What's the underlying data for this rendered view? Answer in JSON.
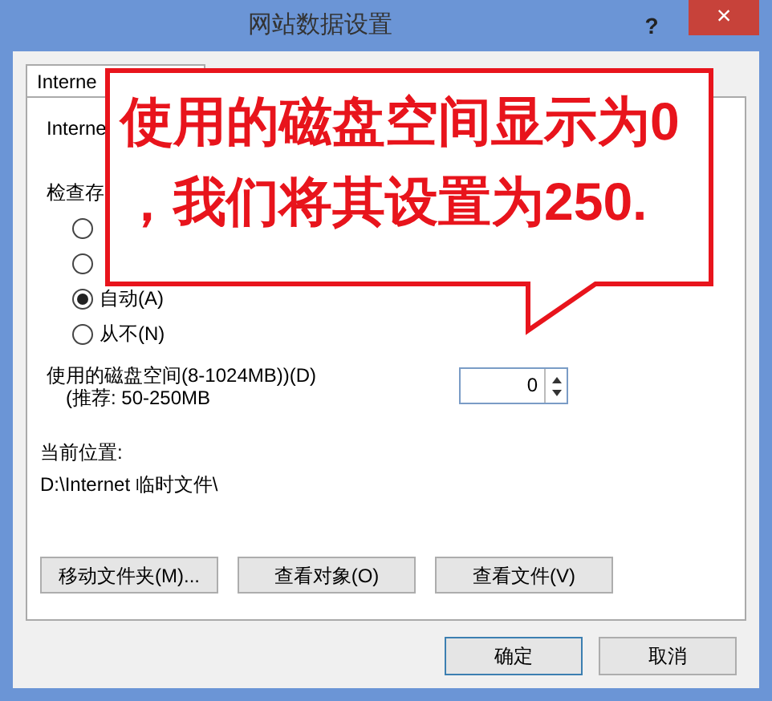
{
  "window": {
    "title": "网站数据设置",
    "help": "?",
    "close": "×"
  },
  "tabs": [
    {
      "label": "Interne",
      "selected": true
    }
  ],
  "panel": {
    "heading": "Interne",
    "check_label": "检查存",
    "radios": [
      {
        "selected": false
      },
      {
        "selected": false
      },
      {
        "label": "自动(A)",
        "selected": true
      },
      {
        "label": "从不(N)",
        "selected": false
      }
    ],
    "disk_label": "使用的磁盘空间(8-1024MB))(D)",
    "disk_hint": "(推荐: 50-250MB",
    "disk_value": "0",
    "location_label": "当前位置:",
    "location": "D:\\Internet 临时文件\\",
    "buttons": [
      "移动文件夹(M)...",
      "查看对象(O)",
      "查看文件(V)"
    ]
  },
  "footer_buttons": [
    {
      "label": "确定",
      "focused": true
    },
    {
      "label": "取消",
      "focused": false
    }
  ],
  "callout": {
    "lines": [
      "使用的磁盘空间显示为0",
      "，我们将其设置为250."
    ]
  }
}
